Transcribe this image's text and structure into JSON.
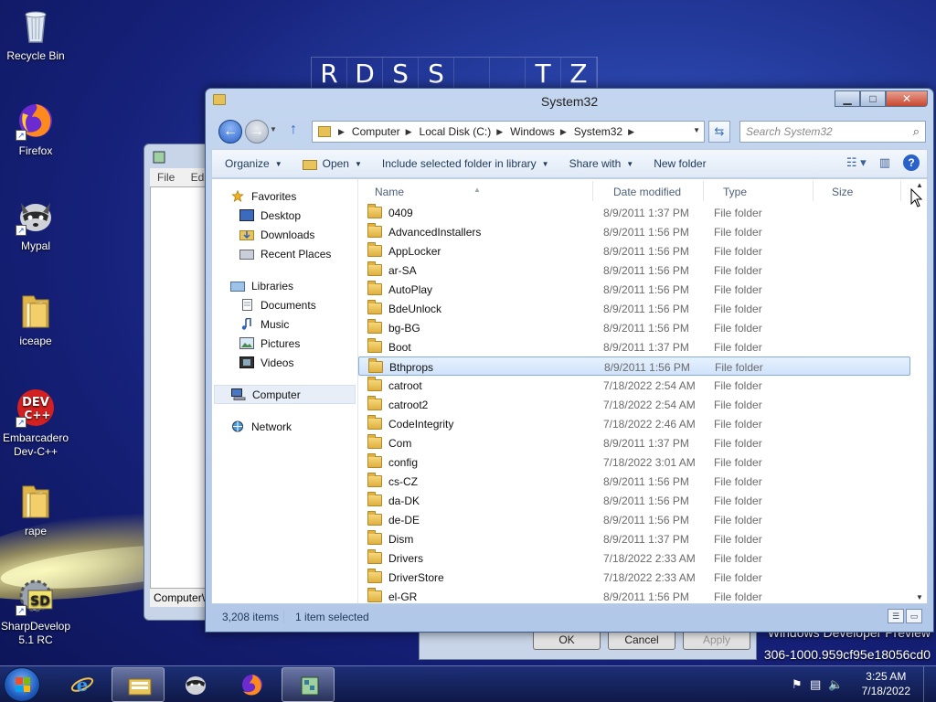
{
  "desktop": {
    "icons": [
      {
        "label": "Recycle Bin",
        "icon": "recycle-bin-icon"
      },
      {
        "label": "Firefox",
        "icon": "firefox-icon"
      },
      {
        "label": "Mypal",
        "icon": "mypal-icon"
      },
      {
        "label": "iceape",
        "icon": "folder-icon"
      },
      {
        "label": "Embarcadero Dev-C++",
        "icon": "devcpp-icon",
        "badge": "DEV C++"
      },
      {
        "label": "rape",
        "icon": "folder-icon"
      },
      {
        "label": "SharpDevelop 5.1 RC",
        "icon": "sharpdevelop-icon",
        "badge": "SD"
      }
    ],
    "banner_letters": [
      "R",
      "D",
      "S",
      "S",
      "",
      "",
      "T",
      "Z"
    ],
    "watermark_line1": "Windows Developer Preview",
    "watermark_line2": "306-1000.959cf95e18056cd0"
  },
  "notepad": {
    "menu": "File  Edit",
    "status": "Computer\\"
  },
  "dialog": {
    "ok": "OK",
    "cancel": "Cancel",
    "apply": "Apply"
  },
  "explorer": {
    "title": "System32",
    "address": [
      "Computer",
      "Local Disk (C:)",
      "Windows",
      "System32"
    ],
    "search_placeholder": "Search System32",
    "toolbar": {
      "organize": "Organize",
      "open": "Open",
      "include": "Include selected folder in library",
      "share": "Share with",
      "new_folder": "New folder"
    },
    "nav": {
      "favorites": "Favorites",
      "desktop": "Desktop",
      "downloads": "Downloads",
      "recent": "Recent Places",
      "libraries": "Libraries",
      "documents": "Documents",
      "music": "Music",
      "pictures": "Pictures",
      "videos": "Videos",
      "computer": "Computer",
      "network": "Network"
    },
    "columns": {
      "name": "Name",
      "date": "Date modified",
      "type": "Type",
      "size": "Size"
    },
    "files": [
      {
        "name": "0409",
        "date": "8/9/2011 1:37 PM",
        "type": "File folder"
      },
      {
        "name": "AdvancedInstallers",
        "date": "8/9/2011 1:56 PM",
        "type": "File folder"
      },
      {
        "name": "AppLocker",
        "date": "8/9/2011 1:56 PM",
        "type": "File folder"
      },
      {
        "name": "ar-SA",
        "date": "8/9/2011 1:56 PM",
        "type": "File folder"
      },
      {
        "name": "AutoPlay",
        "date": "8/9/2011 1:56 PM",
        "type": "File folder"
      },
      {
        "name": "BdeUnlock",
        "date": "8/9/2011 1:56 PM",
        "type": "File folder"
      },
      {
        "name": "bg-BG",
        "date": "8/9/2011 1:56 PM",
        "type": "File folder"
      },
      {
        "name": "Boot",
        "date": "8/9/2011 1:37 PM",
        "type": "File folder"
      },
      {
        "name": "Bthprops",
        "date": "8/9/2011 1:56 PM",
        "type": "File folder",
        "selected": true
      },
      {
        "name": "catroot",
        "date": "7/18/2022 2:54 AM",
        "type": "File folder"
      },
      {
        "name": "catroot2",
        "date": "7/18/2022 2:54 AM",
        "type": "File folder"
      },
      {
        "name": "CodeIntegrity",
        "date": "7/18/2022 2:46 AM",
        "type": "File folder"
      },
      {
        "name": "Com",
        "date": "8/9/2011 1:37 PM",
        "type": "File folder"
      },
      {
        "name": "config",
        "date": "7/18/2022 3:01 AM",
        "type": "File folder"
      },
      {
        "name": "cs-CZ",
        "date": "8/9/2011 1:56 PM",
        "type": "File folder"
      },
      {
        "name": "da-DK",
        "date": "8/9/2011 1:56 PM",
        "type": "File folder"
      },
      {
        "name": "de-DE",
        "date": "8/9/2011 1:56 PM",
        "type": "File folder"
      },
      {
        "name": "Dism",
        "date": "8/9/2011 1:37 PM",
        "type": "File folder"
      },
      {
        "name": "Drivers",
        "date": "7/18/2022 2:33 AM",
        "type": "File folder"
      },
      {
        "name": "DriverStore",
        "date": "7/18/2022 2:33 AM",
        "type": "File folder"
      },
      {
        "name": "el-GR",
        "date": "8/9/2011 1:56 PM",
        "type": "File folder"
      }
    ],
    "status_count": "3,208 items",
    "status_selected": "1 item selected"
  },
  "taskbar": {
    "time": "3:25 AM",
    "date": "7/18/2022"
  }
}
